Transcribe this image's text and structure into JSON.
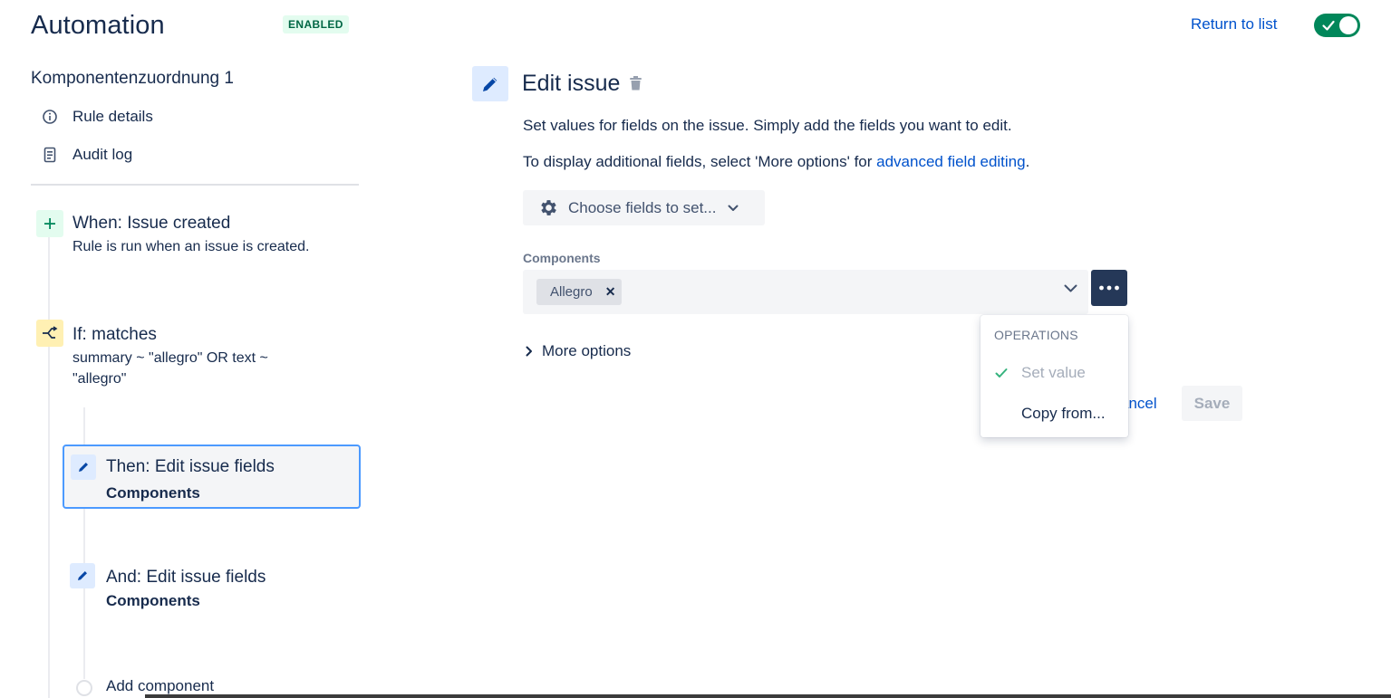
{
  "header": {
    "title": "Automation",
    "status_badge": "ENABLED",
    "return_link": "Return to list",
    "toggle_on": true
  },
  "sidebar": {
    "rule_name": "Komponentenzuordnung 1",
    "nav": [
      {
        "label": "Rule details",
        "icon": "info-icon"
      },
      {
        "label": "Audit log",
        "icon": "document-icon"
      }
    ],
    "trigger": {
      "title": "When: Issue created",
      "description": "Rule is run when an issue is created."
    },
    "condition": {
      "title": "If: matches",
      "description_line1": "summary ~ \"allegro\" OR text ~",
      "description_line2": "\"allegro\""
    },
    "actions": [
      {
        "title": "Then: Edit issue fields",
        "subtitle": "Components",
        "selected": true
      },
      {
        "title": "And: Edit issue fields",
        "subtitle": "Components",
        "selected": false
      }
    ],
    "add_component": "Add component"
  },
  "editor": {
    "title": "Edit issue",
    "description": "Set values for fields on the issue. Simply add the fields you want to edit.",
    "additional_prefix": "To display additional fields, select 'More options' for ",
    "additional_link": "advanced field editing",
    "additional_suffix": ".",
    "choose_fields_label": "Choose fields to set...",
    "field_label": "Components",
    "field_tags": [
      "Allegro"
    ],
    "more_options_label": "More options",
    "cancel_label": "ancel",
    "save_label": "Save"
  },
  "operations_menu": {
    "heading": "OPERATIONS",
    "items": [
      {
        "label": "Set value",
        "checked": true,
        "disabled": true
      },
      {
        "label": "Copy from...",
        "checked": false,
        "disabled": false
      }
    ]
  },
  "colors": {
    "accent": "#0052cc",
    "toggle_on": "#00875a",
    "badge_bg": "#e3fcef",
    "badge_text": "#006644",
    "selected_border": "#4c9aff",
    "dots_button": "#253858"
  }
}
